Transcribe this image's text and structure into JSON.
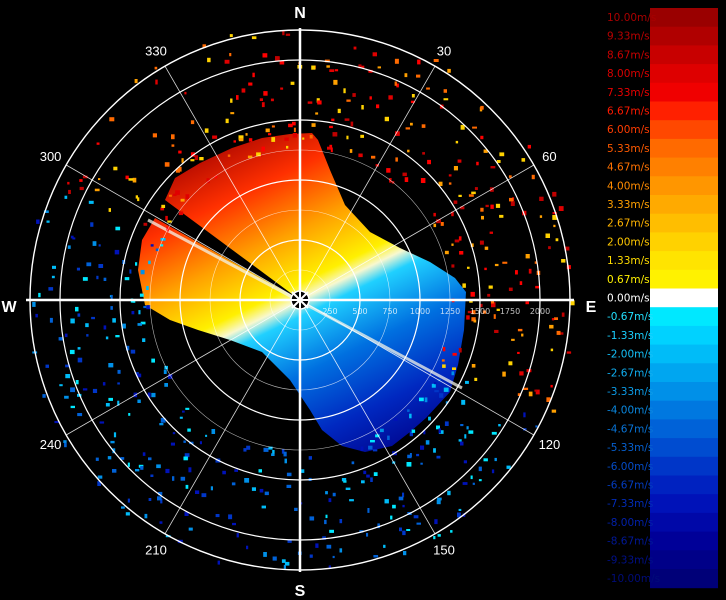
{
  "app": {
    "panel": "radial-velocity-ppi-display"
  },
  "compass": {
    "north": "N",
    "east": "E",
    "south": "S",
    "west": "W"
  },
  "azimuth_labels": [
    {
      "angle": 30,
      "text": "30"
    },
    {
      "angle": 60,
      "text": "60"
    },
    {
      "angle": 120,
      "text": "120"
    },
    {
      "angle": 150,
      "text": "150"
    },
    {
      "angle": 210,
      "text": "210"
    },
    {
      "angle": 240,
      "text": "240"
    },
    {
      "angle": 300,
      "text": "300"
    },
    {
      "angle": 330,
      "text": "330"
    }
  ],
  "range_labels": [
    {
      "value": 250,
      "text": "250"
    },
    {
      "value": 500,
      "text": "500"
    },
    {
      "value": 750,
      "text": "750"
    },
    {
      "value": 1000,
      "text": "1000"
    },
    {
      "value": 1250,
      "text": "1250"
    },
    {
      "value": 1500,
      "text": "1500"
    },
    {
      "value": 1750,
      "text": "1750"
    },
    {
      "value": 2000,
      "text": "2000"
    }
  ],
  "range_max": 2250,
  "color_scale": [
    {
      "label": "10.00m/s",
      "color": "#9a0000",
      "text_color": "#a80000"
    },
    {
      "label": "9.33m/s",
      "color": "#b00000",
      "text_color": "#b80000"
    },
    {
      "label": "8.67m/s",
      "color": "#c80000",
      "text_color": "#c80000"
    },
    {
      "label": "8.00m/s",
      "color": "#de0000",
      "text_color": "#d80000"
    },
    {
      "label": "7.33m/s",
      "color": "#f00000",
      "text_color": "#e80000"
    },
    {
      "label": "6.67m/s",
      "color": "#ff2000",
      "text_color": "#ff1a00"
    },
    {
      "label": "6.00m/s",
      "color": "#ff4800",
      "text_color": "#ff3c00"
    },
    {
      "label": "5.33m/s",
      "color": "#ff6a00",
      "text_color": "#ff5a00"
    },
    {
      "label": "4.67m/s",
      "color": "#ff8000",
      "text_color": "#ff7200"
    },
    {
      "label": "4.00m/s",
      "color": "#ff9600",
      "text_color": "#ff8c00"
    },
    {
      "label": "3.33m/s",
      "color": "#ffaa00",
      "text_color": "#ffa000"
    },
    {
      "label": "2.67m/s",
      "color": "#ffbe00",
      "text_color": "#ffb400"
    },
    {
      "label": "2.00m/s",
      "color": "#ffd200",
      "text_color": "#ffc800"
    },
    {
      "label": "1.33m/s",
      "color": "#ffe400",
      "text_color": "#ffdc00"
    },
    {
      "label": "0.67m/s",
      "color": "#fff200",
      "text_color": "#fff000"
    },
    {
      "label": "0.00m/s",
      "color": "#ffffff",
      "text_color": "#ffffff"
    },
    {
      "label": "-0.67m/s",
      "color": "#00e8ff",
      "text_color": "#22e0ff"
    },
    {
      "label": "-1.33m/s",
      "color": "#00d2ff",
      "text_color": "#1ad0ff"
    },
    {
      "label": "-2.00m/s",
      "color": "#00bcf8",
      "text_color": "#14c0f8"
    },
    {
      "label": "-2.67m/s",
      "color": "#00a6f0",
      "text_color": "#10aef0"
    },
    {
      "label": "-3.33m/s",
      "color": "#0090e8",
      "text_color": "#0c9ce8"
    },
    {
      "label": "-4.00m/s",
      "color": "#0078e0",
      "text_color": "#0a88e0"
    },
    {
      "label": "-4.67m/s",
      "color": "#0062d8",
      "text_color": "#0874d8"
    },
    {
      "label": "-5.33m/s",
      "color": "#004cd0",
      "text_color": "#0660d0"
    },
    {
      "label": "-6.00m/s",
      "color": "#0036c8",
      "text_color": "#044cc8"
    },
    {
      "label": "-6.67m/s",
      "color": "#0022c0",
      "text_color": "#033cc0"
    },
    {
      "label": "-7.33m/s",
      "color": "#0012b8",
      "text_color": "#022cb8"
    },
    {
      "label": "-8.00m/s",
      "color": "#0008a8",
      "text_color": "#0220a8"
    },
    {
      "label": "-8.67m/s",
      "color": "#000098",
      "text_color": "#011898"
    },
    {
      "label": "-9.33m/s",
      "color": "#000088",
      "text_color": "#011088"
    },
    {
      "label": "-10.00m/s",
      "color": "#000078",
      "text_color": "#000c78"
    }
  ]
}
